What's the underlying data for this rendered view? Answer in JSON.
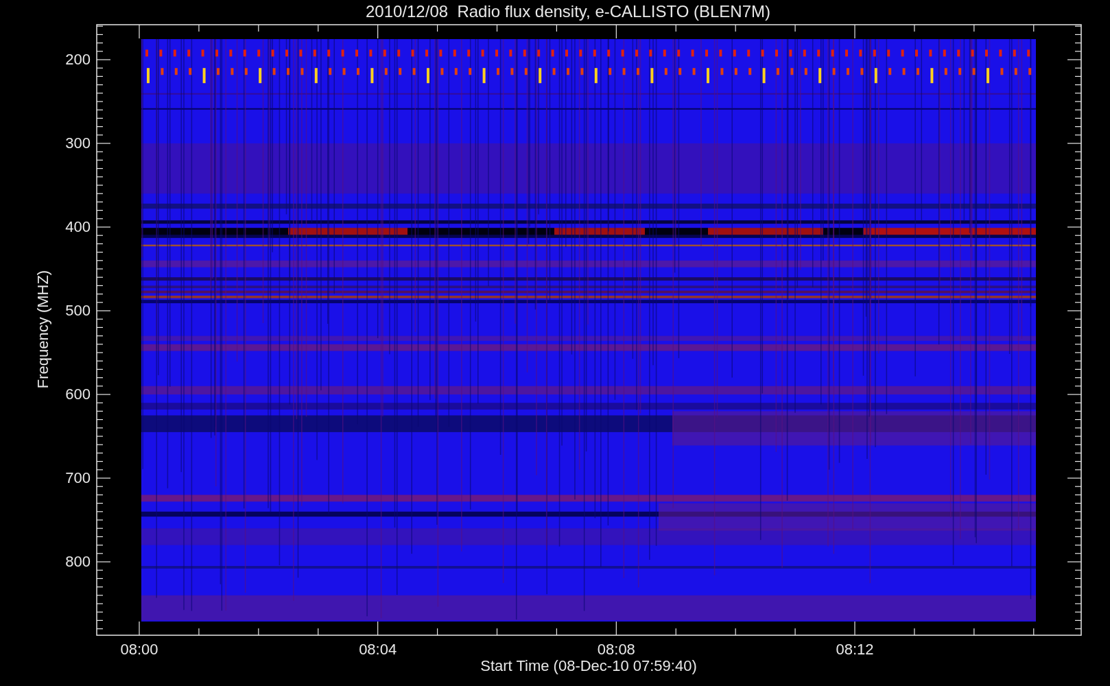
{
  "title": "2010/12/08  Radio flux density, e-CALLISTO (BLEN7M)",
  "y_axis": {
    "label": "Frequency (MHZ)",
    "ticks": [
      "200",
      "300",
      "400",
      "500",
      "600",
      "700",
      "800"
    ]
  },
  "x_axis": {
    "label": "Start Time (08-Dec-10 07:59:40)",
    "ticks": [
      "08:00",
      "08:04",
      "08:08",
      "08:12"
    ]
  }
}
